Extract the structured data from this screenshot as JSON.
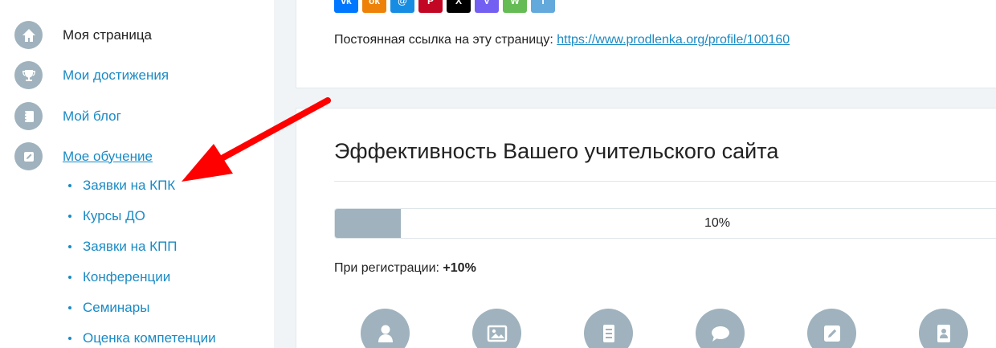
{
  "sidebar": {
    "items": [
      {
        "label": "Моя страница",
        "icon": "home-icon"
      },
      {
        "label": "Мои достижения",
        "icon": "trophy-icon"
      },
      {
        "label": "Мой блог",
        "icon": "notebook-icon"
      },
      {
        "label": "Мое обучение",
        "icon": "edit-icon"
      }
    ],
    "sub_items": [
      {
        "label": "Заявки на КПК"
      },
      {
        "label": "Курсы ДО"
      },
      {
        "label": "Заявки на КПП"
      },
      {
        "label": "Конференции"
      },
      {
        "label": "Семинары"
      },
      {
        "label": "Оценка компетенции"
      }
    ]
  },
  "share": {
    "buttons": [
      {
        "icon": "vk-icon",
        "glyph": "vk",
        "color": "#0077ff"
      },
      {
        "icon": "odnoklassniki-icon",
        "glyph": "ok",
        "color": "#ee8208"
      },
      {
        "icon": "mailru-icon",
        "glyph": "@",
        "color": "#168de2"
      },
      {
        "icon": "pinterest-icon",
        "glyph": "P",
        "color": "#c20724"
      },
      {
        "icon": "x-icon",
        "glyph": "X",
        "color": "#000000"
      },
      {
        "icon": "viber-icon",
        "glyph": "V",
        "color": "#7360f2"
      },
      {
        "icon": "whatsapp-icon",
        "glyph": "W",
        "color": "#65bc54"
      },
      {
        "icon": "telegram-icon",
        "glyph": "T",
        "color": "#64a9dc"
      }
    ],
    "permalink_label": "Постоянная ссылка на эту страницу:",
    "permalink_url": "https://www.prodlenka.org/profile/100160"
  },
  "effectiveness": {
    "title": "Эффективность Вашего учительского сайта",
    "progress_text": "10%",
    "progress_value": 0.1,
    "registration_label": "При регистрации:",
    "registration_value": "+10%"
  },
  "features": [
    {
      "icon": "profile-icon"
    },
    {
      "icon": "image-icon"
    },
    {
      "icon": "document-icon"
    },
    {
      "icon": "chat-icon"
    },
    {
      "icon": "edit-icon"
    },
    {
      "icon": "certificate-icon"
    }
  ],
  "colors": {
    "accent": "#1a8ac4",
    "icon_bg": "#9fb2bd",
    "arrow": "#ff0000"
  }
}
